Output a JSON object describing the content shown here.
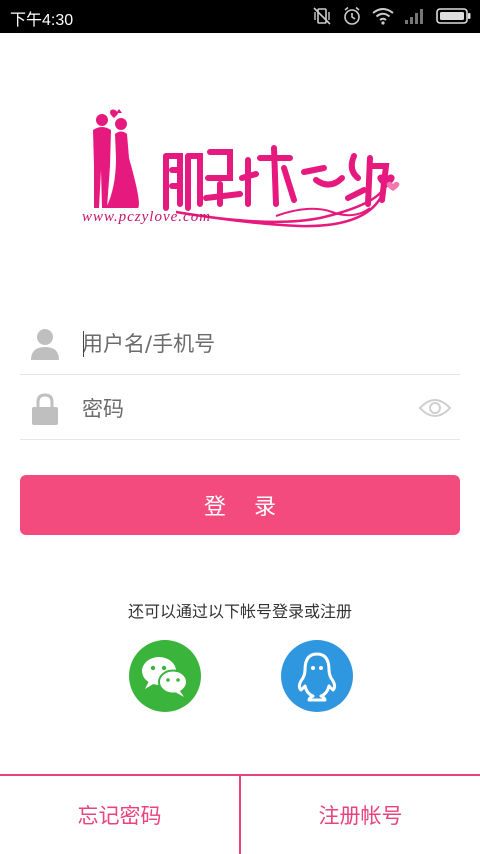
{
  "status_bar": {
    "time": "下午4:30",
    "icons": [
      "vibrate-off-icon",
      "alarm-icon",
      "wifi-icon",
      "signal-icon",
      "battery-icon"
    ]
  },
  "logo": {
    "alt": "鹏城之约",
    "url_text": "www.pczylove.com",
    "brand_color": "#e6197f"
  },
  "form": {
    "username_placeholder": "用户名/手机号",
    "password_placeholder": "密码",
    "login_label": "登录"
  },
  "third_party": {
    "prompt": "还可以通过以下帐号登录或注册",
    "providers": [
      "wechat",
      "qq"
    ],
    "wechat_color": "#3ab43a",
    "qq_color": "#2f97e0"
  },
  "bottom": {
    "forgot_label": "忘记密码",
    "register_label": "注册帐号"
  },
  "colors": {
    "accent": "#f34b7d",
    "bottom_accent": "#e8437a"
  }
}
